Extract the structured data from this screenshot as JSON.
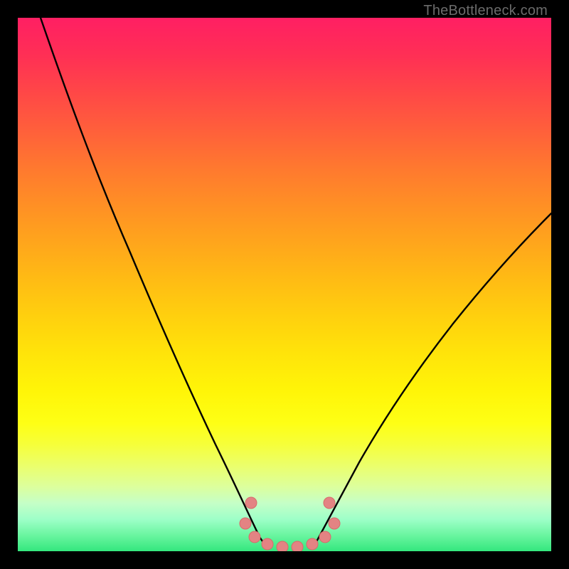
{
  "watermark": "TheBottleneck.com",
  "chart_data": {
    "type": "line",
    "title": "",
    "xlabel": "",
    "ylabel": "",
    "xlim": [
      0,
      100
    ],
    "ylim": [
      0,
      100
    ],
    "grid": false,
    "legend": false,
    "background_gradient": {
      "direction": "vertical",
      "stops": [
        {
          "pos": 0.0,
          "color": "#ff1f63"
        },
        {
          "pos": 0.25,
          "color": "#ff6a34"
        },
        {
          "pos": 0.5,
          "color": "#ffbf12"
        },
        {
          "pos": 0.72,
          "color": "#fff608"
        },
        {
          "pos": 0.88,
          "color": "#dcff9e"
        },
        {
          "pos": 1.0,
          "color": "#34e77e"
        }
      ]
    },
    "series": [
      {
        "name": "left_branch",
        "stroke": "#000000",
        "stroke_width": 2,
        "x": [
          4,
          8,
          12,
          16,
          20,
          24,
          28,
          32,
          36,
          40,
          43,
          45,
          46.5
        ],
        "y": [
          100,
          87,
          74,
          62,
          51,
          41,
          32,
          24,
          17,
          10,
          5,
          2,
          0.5
        ]
      },
      {
        "name": "right_branch",
        "stroke": "#000000",
        "stroke_width": 2,
        "x": [
          55.5,
          57,
          60,
          64,
          68,
          73,
          78,
          83,
          88,
          94,
          100
        ],
        "y": [
          0.5,
          2,
          5,
          10,
          17,
          25,
          33,
          41,
          49,
          57,
          64
        ]
      },
      {
        "name": "flat_bottom_dots",
        "type": "scatter",
        "stroke": "#e07a7a",
        "marker_radius_px": 8,
        "x": [
          42.5,
          44.3,
          46.7,
          49.5,
          52.3,
          55.1,
          57.6,
          59.3,
          43.7,
          58.4
        ],
        "y": [
          5.2,
          2.6,
          1.3,
          1.0,
          1.0,
          1.3,
          2.6,
          5.2,
          9.0,
          9.0
        ]
      }
    ],
    "annotations": []
  }
}
